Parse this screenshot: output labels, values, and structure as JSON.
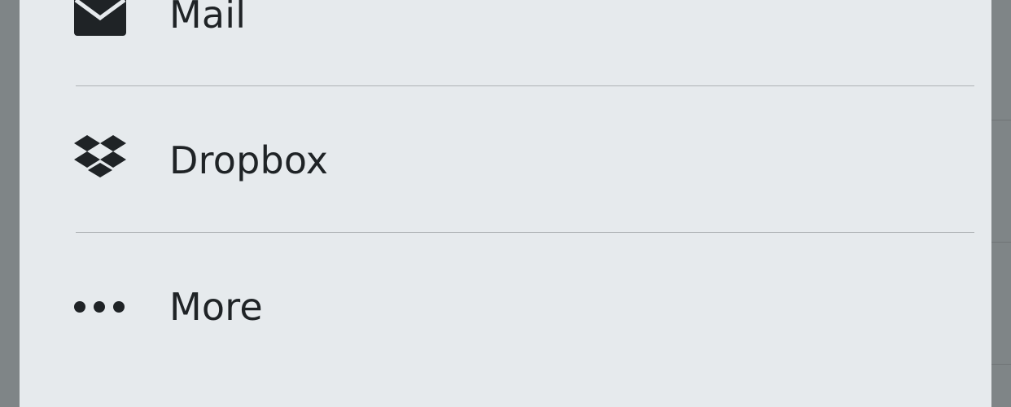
{
  "share_sheet": {
    "items": [
      {
        "label": "Mail",
        "icon": "mail-icon"
      },
      {
        "label": "Dropbox",
        "icon": "dropbox-icon"
      },
      {
        "label": "More",
        "icon": "more-dots-icon"
      }
    ]
  },
  "colors": {
    "sheet_background": "#e6eaed",
    "dimmed_backdrop": "#7f8587",
    "text": "#1f2326",
    "separator": "#aeb2b5"
  }
}
